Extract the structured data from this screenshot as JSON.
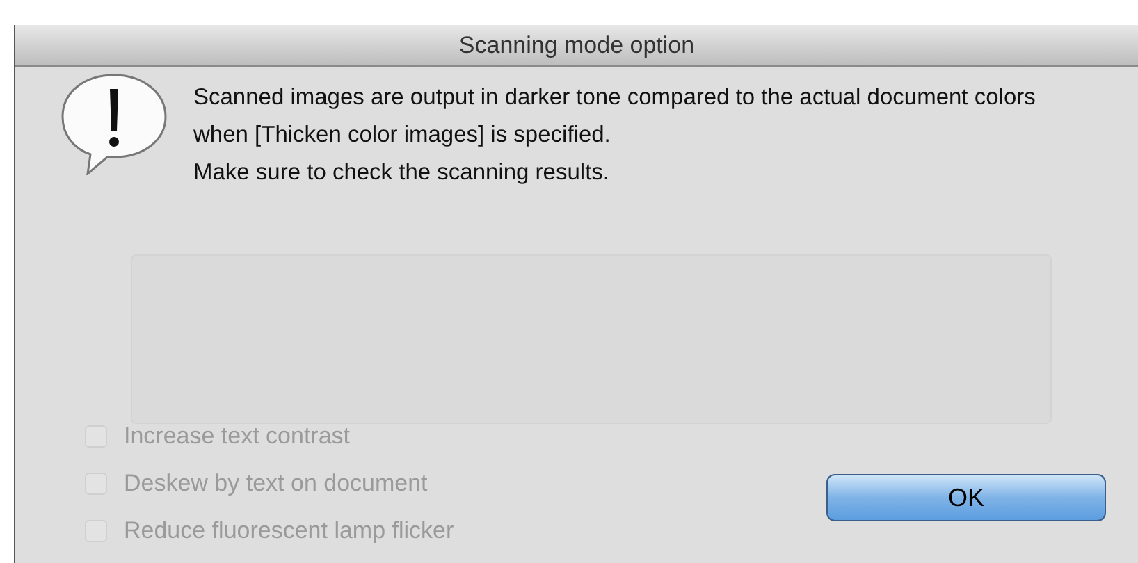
{
  "window": {
    "title": "Scanning mode option"
  },
  "message": [
    "Scanned images are output in darker tone compared to the actual document colors when [Thicken color images] is specified.",
    "Make sure to check the scanning results."
  ],
  "background_options": [
    {
      "label": "Increase text contrast",
      "checked": false
    },
    {
      "label": "Deskew by text on document",
      "checked": false
    },
    {
      "label": "Reduce fluorescent lamp flicker",
      "checked": false
    }
  ],
  "buttons": [
    {
      "label": "OK",
      "default": true
    }
  ]
}
